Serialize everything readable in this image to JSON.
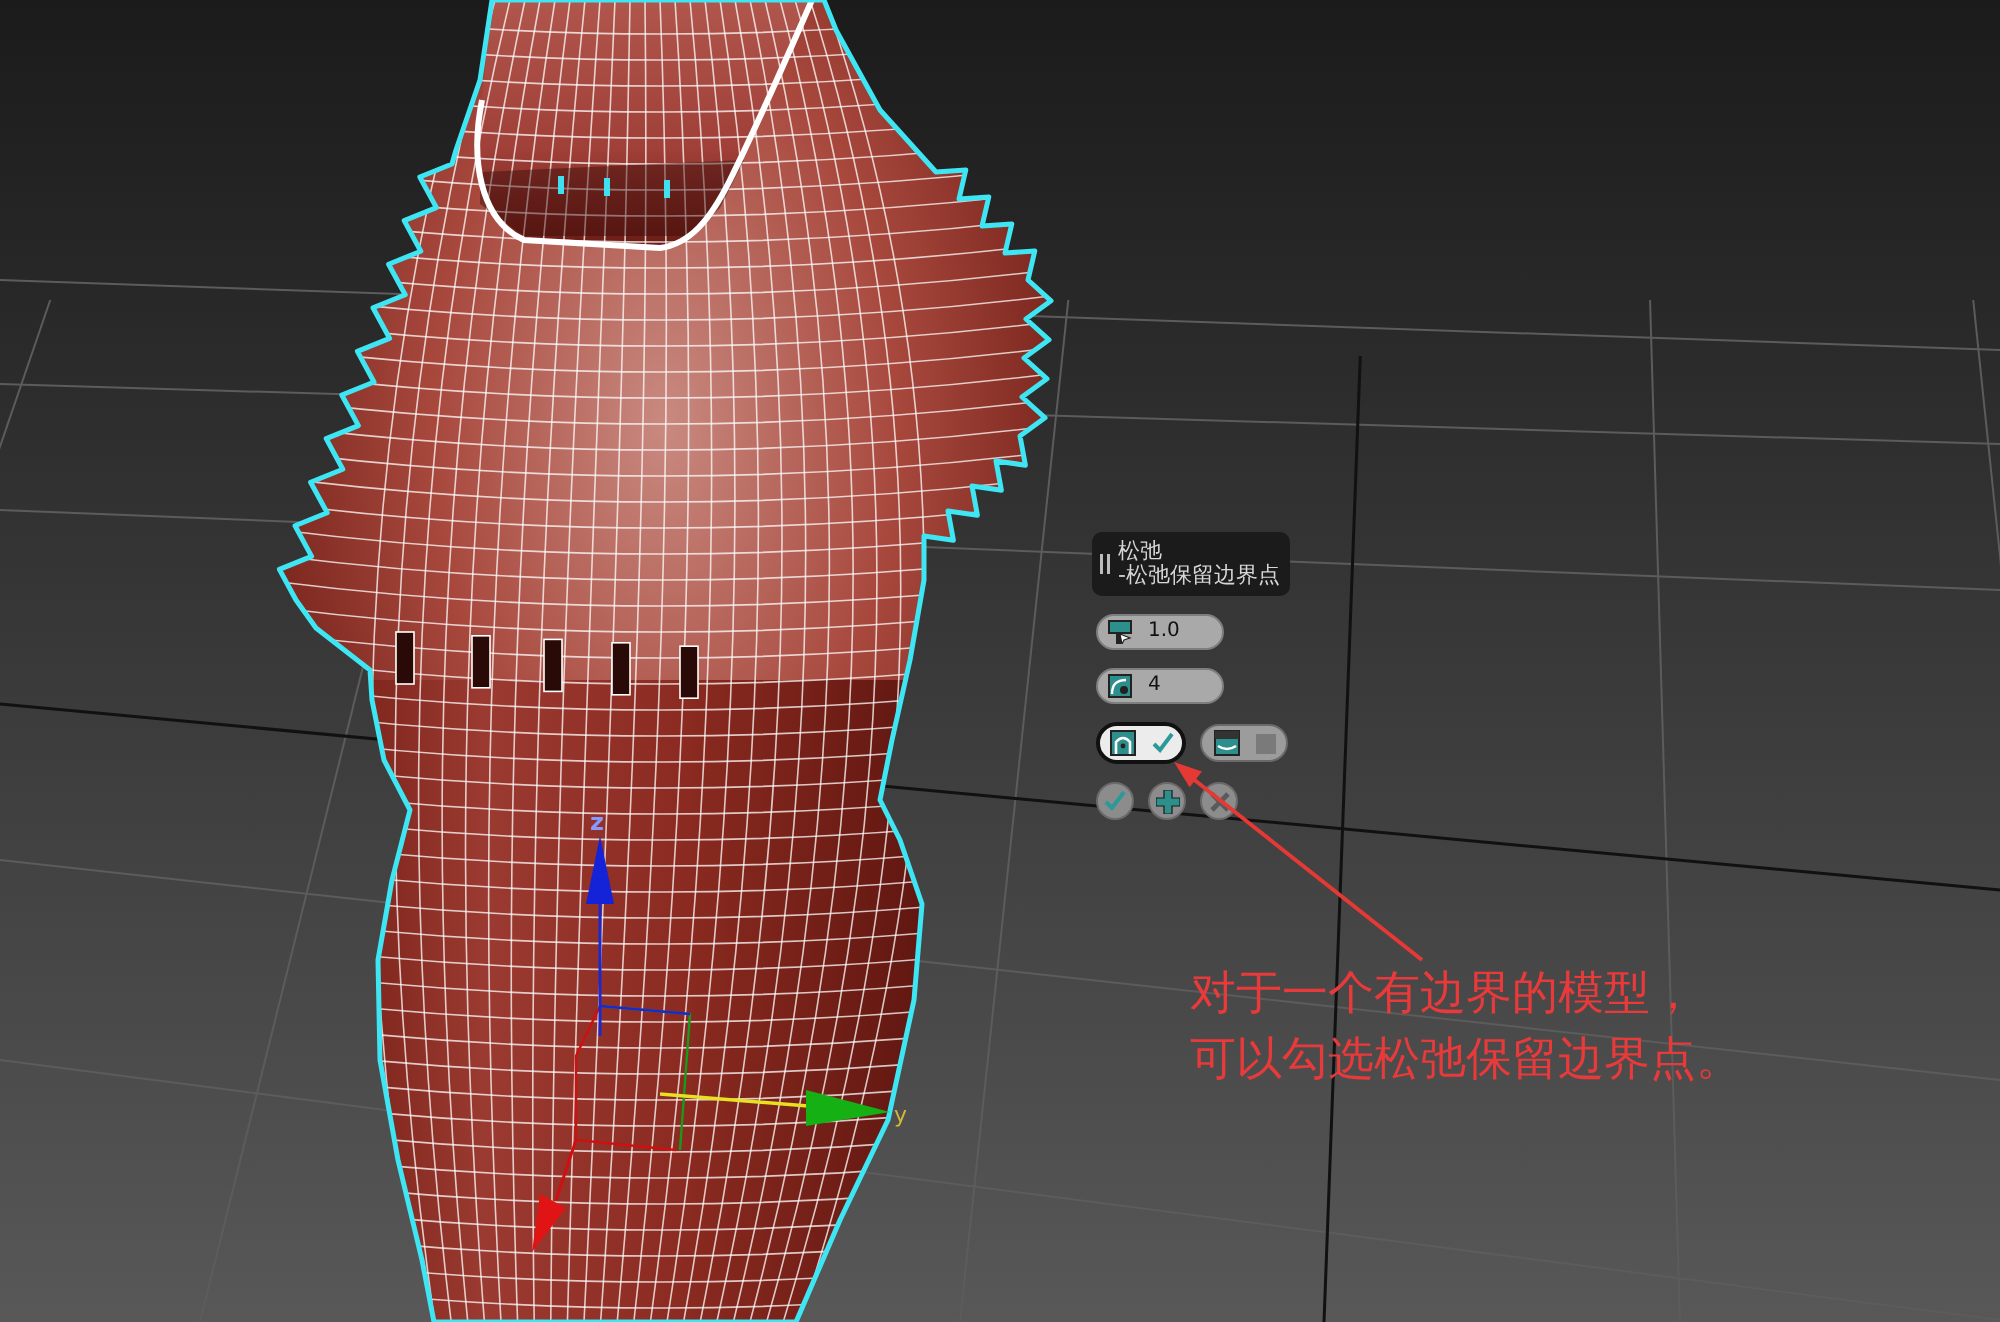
{
  "gizmo": {
    "z_label": "z",
    "y_label": "y"
  },
  "caddy": {
    "title": "松弛",
    "subtitle": "-松弛保留边界点",
    "fields": [
      {
        "kind": "amount",
        "value": "1.0"
      },
      {
        "kind": "iterations",
        "value": "4"
      }
    ],
    "toggles": [
      {
        "kind": "keep_boundary",
        "checked": true
      },
      {
        "kind": "outer_corners",
        "checked": false
      }
    ],
    "buttons": [
      {
        "kind": "ok"
      },
      {
        "kind": "apply"
      },
      {
        "kind": "cancel"
      }
    ]
  },
  "annotation": {
    "lines": [
      "对于一个有边界的模型，",
      "可以勾选松弛保留边界点。"
    ]
  }
}
